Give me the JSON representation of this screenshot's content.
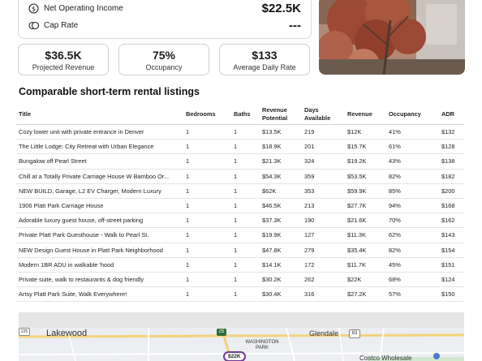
{
  "financials": {
    "noi_label": "Net Operating Income",
    "noi_value": "$22.5K",
    "cap_label": "Cap Rate",
    "cap_value": "---"
  },
  "kpis": {
    "revenue_value": "$36.5K",
    "revenue_label": "Projected Revenue",
    "occupancy_value": "75%",
    "occupancy_label": "Occupancy",
    "adr_value": "$133",
    "adr_label": "Average Daily Rate"
  },
  "comps": {
    "title": "Comparable short-term rental listings",
    "columns": [
      "Title",
      "Bedrooms",
      "Baths",
      "Revenue Potential",
      "Days Available",
      "Revenue",
      "Occupancy",
      "ADR"
    ],
    "rows": [
      [
        "Cozy lower unit with private entrance in Denver",
        "1",
        "1",
        "$13.5K",
        "219",
        "$12K",
        "41%",
        "$132"
      ],
      [
        "The Little Lodge: City Retreat with Urban Elegance",
        "1",
        "1",
        "$18.9K",
        "201",
        "$15.7K",
        "61%",
        "$128"
      ],
      [
        "Bungalow off Pearl Street",
        "1",
        "1",
        "$21.3K",
        "324",
        "$19.2K",
        "43%",
        "$138"
      ],
      [
        "Chill at a Totally Private Carriage House W Bamboo Or...",
        "1",
        "1",
        "$54.3K",
        "359",
        "$53.5K",
        "82%",
        "$182"
      ],
      [
        "NEW BUILD, Garage, L2 EV Charger, Modern Luxury",
        "1",
        "1",
        "$62K",
        "353",
        "$59.9K",
        "85%",
        "$200"
      ],
      [
        "1906 Platt Park Carriage House",
        "1",
        "1",
        "$46.5K",
        "213",
        "$27.7K",
        "94%",
        "$168"
      ],
      [
        "Adorable luxury guest house, off-street parking",
        "1",
        "1",
        "$37.3K",
        "190",
        "$21.6K",
        "70%",
        "$162"
      ],
      [
        "Private Platt Park Guesthouse - Walk to Pearl St.",
        "1",
        "1",
        "$19.9K",
        "127",
        "$11.3K",
        "62%",
        "$143"
      ],
      [
        "NEW Design Guest House in Platt Park Neighborhood",
        "1",
        "1",
        "$47.8K",
        "279",
        "$35.4K",
        "82%",
        "$154"
      ],
      [
        "Modern 1BR ADU in walkable 'hood",
        "1",
        "1",
        "$14.1K",
        "172",
        "$11.7K",
        "45%",
        "$151"
      ],
      [
        "Private suite, walk to restaurants & dog friendly",
        "1",
        "1",
        "$30.2K",
        "262",
        "$22K",
        "68%",
        "$124"
      ],
      [
        "Artsy Platt Park Suite, Walk Everywhere!",
        "1",
        "1",
        "$30.4K",
        "316",
        "$27.2K",
        "57%",
        "$150"
      ]
    ]
  },
  "map": {
    "city_lakewood": "Lakewood",
    "city_glendale": "Glendale",
    "neighborhood": "WASHINGTON PARK",
    "store": "Costco Wholesale",
    "pin_label": "$22K",
    "shield_25": "25",
    "shield_83": "83",
    "shield_225": "225"
  }
}
